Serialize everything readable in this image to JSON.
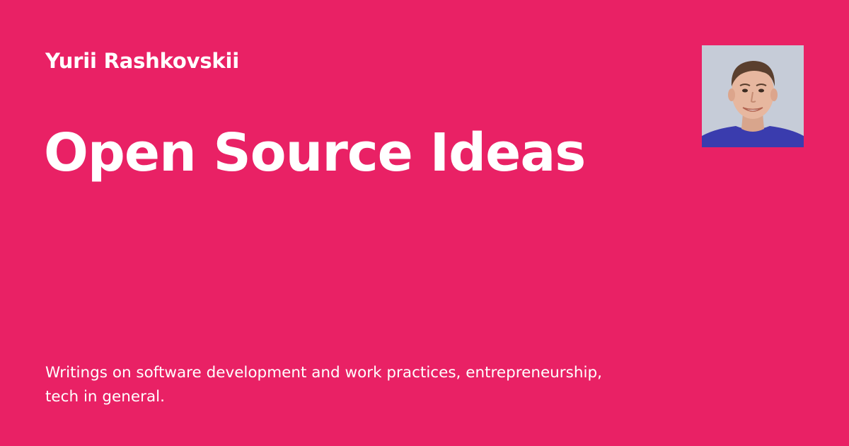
{
  "author": {
    "name": "Yurii Rashkovskii"
  },
  "site": {
    "title": "Open Source Ideas",
    "description": "Writings on software development and work practices, entrepreneurship, tech in general."
  },
  "avatar": {
    "icon": "person-photo"
  },
  "colors": {
    "background": "#e92165",
    "text": "#ffffff"
  }
}
